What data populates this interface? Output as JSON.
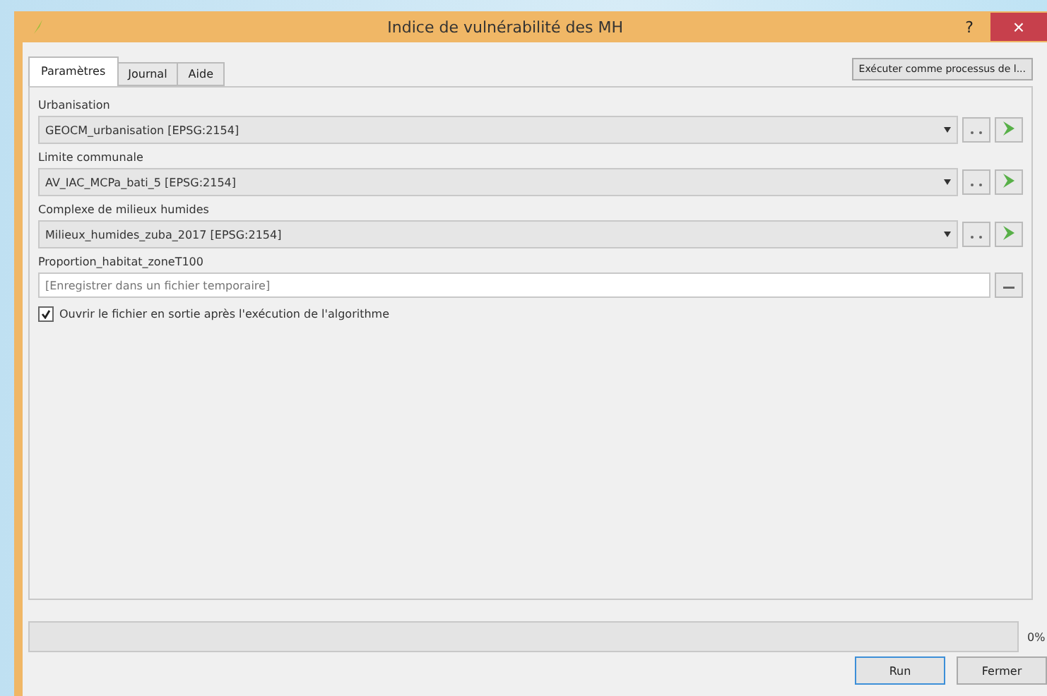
{
  "window": {
    "title": "Indice de vulnérabilité des MH",
    "close": "×",
    "help": "?"
  },
  "tabs": [
    {
      "label": "Paramètres",
      "selected": true
    },
    {
      "label": "Journal",
      "selected": false
    },
    {
      "label": "Aide",
      "selected": false
    }
  ],
  "batch_button": "Exécuter comme processus de l...",
  "parameters": [
    {
      "kind": "layer",
      "label": "Urbanisation",
      "value": "GEOCM_urbanisation [EPSG:2154]"
    },
    {
      "kind": "layer",
      "label": "Limite communale",
      "value": "AV_IAC_MCPa_bati_5 [EPSG:2154]"
    },
    {
      "kind": "layer",
      "label": "Complexe de milieux humides",
      "value": "Milieux_humides_zuba_2017 [EPSG:2154]"
    },
    {
      "kind": "output",
      "label": "Proportion_habitat_zoneT100",
      "placeholder": "[Enregistrer dans un fichier temporaire]"
    }
  ],
  "open_output": {
    "label": "Ouvrir le fichier en sortie après l'exécution de l'algorithme",
    "checked": true
  },
  "progress": {
    "level": 0,
    "reading": "0%"
  },
  "buttons": [
    "Run",
    "Fermer"
  ]
}
